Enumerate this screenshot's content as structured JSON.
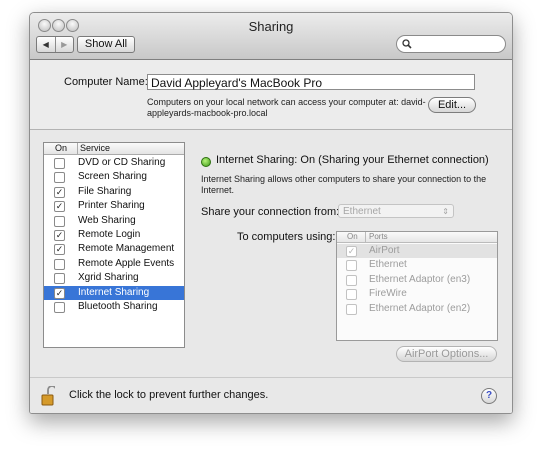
{
  "window": {
    "title": "Sharing"
  },
  "toolbar": {
    "back": "◀",
    "forward": "▶",
    "show_all": "Show All",
    "search_placeholder": ""
  },
  "computer": {
    "name_label": "Computer Name:",
    "name_value": "David Appleyard's MacBook Pro",
    "info_line1": "Computers on your local network can access your computer at: david-",
    "info_line2": "appleyards-macbook-pro.local",
    "edit_label": "Edit..."
  },
  "services": {
    "col_on": "On",
    "col_service": "Service",
    "items": [
      {
        "label": "DVD or CD Sharing",
        "checked": false
      },
      {
        "label": "Screen Sharing",
        "checked": false
      },
      {
        "label": "File Sharing",
        "checked": true
      },
      {
        "label": "Printer Sharing",
        "checked": true
      },
      {
        "label": "Web Sharing",
        "checked": false
      },
      {
        "label": "Remote Login",
        "checked": true
      },
      {
        "label": "Remote Management",
        "checked": true
      },
      {
        "label": "Remote Apple Events",
        "checked": false
      },
      {
        "label": "Xgrid Sharing",
        "checked": false
      },
      {
        "label": "Internet Sharing",
        "checked": true,
        "selected": true
      },
      {
        "label": "Bluetooth Sharing",
        "checked": false
      }
    ]
  },
  "detail": {
    "status": "Internet Sharing: On (Sharing your Ethernet connection)",
    "description_line1": "Internet Sharing allows other computers to share your connection to the",
    "description_line2": "Internet.",
    "share_from_label": "Share your connection from:",
    "share_from_value": "Ethernet",
    "to_computers_label": "To computers using:",
    "ports_col_on": "On",
    "ports_col_ports": "Ports",
    "ports": [
      {
        "label": "AirPort",
        "checked": true
      },
      {
        "label": "Ethernet",
        "checked": false
      },
      {
        "label": "Ethernet Adaptor (en3)",
        "checked": false
      },
      {
        "label": "FireWire",
        "checked": false
      },
      {
        "label": "Ethernet Adaptor (en2)",
        "checked": false
      }
    ],
    "airport_options_label": "AirPort Options..."
  },
  "footer": {
    "lock_text": "Click the lock to prevent further changes.",
    "help": "?"
  },
  "colors": {
    "selection": "#3875d7",
    "status_on": "#3d9a17"
  }
}
